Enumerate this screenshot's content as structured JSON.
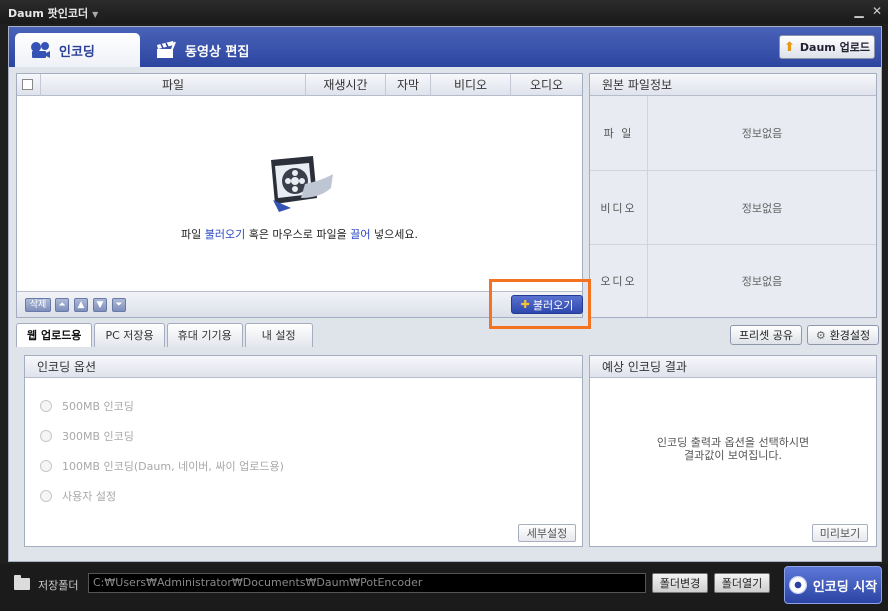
{
  "titlebar": {
    "title": "Daum 팟인코더",
    "menu_arrow": "▼",
    "minimize": "▁",
    "close": "✕"
  },
  "tabs": {
    "encode": {
      "label": "인코딩",
      "icon": "film-camera-icon"
    },
    "edit": {
      "label": "동영상 편집",
      "icon": "clapper-icon"
    }
  },
  "upload_button": {
    "label": "Daum 업로드",
    "icon": "arrow-up-icon"
  },
  "file_table": {
    "columns": [
      "파일",
      "재생시간",
      "자막",
      "비디오",
      "오디오"
    ],
    "placeholder_parts": [
      "파일 ",
      "불러오기",
      " 혹은 마우스로 파일을 ",
      "끌어",
      " 넣으세요."
    ],
    "toolbar": {
      "delete": "삭제",
      "top": "⏶",
      "up": "▲",
      "down": "▼",
      "bottom": "⏷"
    },
    "load_button": "불러오기"
  },
  "source_info": {
    "title": "원본 파일정보",
    "rows": [
      {
        "label": "파 일",
        "value": "정보없음"
      },
      {
        "label": "비디오",
        "value": "정보없음"
      },
      {
        "label": "오디오",
        "value": "정보없음"
      }
    ]
  },
  "subtabs": [
    "웹 업로드용",
    "PC 저장용",
    "휴대 기기용",
    "내 설정"
  ],
  "preset_share": "프리셋 공유",
  "settings": {
    "label": "환경설정",
    "icon": "gear-icon"
  },
  "encode_options": {
    "title": "인코딩 옵션",
    "options": [
      "500MB 인코딩",
      "300MB 인코딩",
      "100MB 인코딩(Daum, 네이버, 싸이 업로드용)",
      "사용자 설정"
    ],
    "detail_button": "세부설정"
  },
  "expected_result": {
    "title": "예상 인코딩 결과",
    "message_line1": "인코딩 출력과 옵션을 선택하시면",
    "message_line2": "결과값이 보여집니다.",
    "preview_button": "미리보기"
  },
  "bottom": {
    "save_folder_label": "저장폴더",
    "path": "C:₩Users₩Administrator₩Documents₩Daum₩PotEncoder",
    "change_folder": "폴더변경",
    "open_folder": "폴더열기",
    "start_button": "인코딩 시작"
  },
  "colors": {
    "accent": "#2c45a0",
    "highlight": "#f47321",
    "link": "#2a48c4"
  }
}
